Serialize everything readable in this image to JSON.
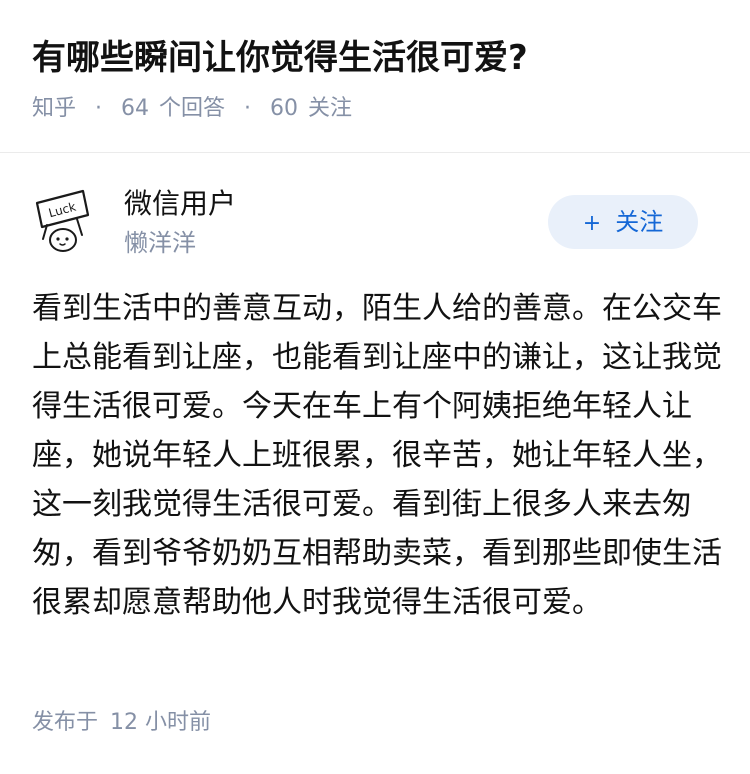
{
  "question": {
    "title": "有哪些瞬间让你觉得生活很可爱?",
    "source": "知乎",
    "separator": "·",
    "answer_count": "64",
    "answer_label": "个回答",
    "follower_count": "60",
    "follower_label": "关注"
  },
  "author": {
    "avatar_icon": "luck-sign-avatar-icon",
    "avatar_text": "Luck",
    "name": "微信用户",
    "bio": "懒洋洋",
    "follow_icon": "plus-icon",
    "follow_plus": "+",
    "follow_label": "关注"
  },
  "answer": {
    "content": "看到生活中的善意互动，陌生人给的善意。在公交车上总能看到让座，也能看到让座中的谦让，这让我觉得生活很可爱。今天在车上有个阿姨拒绝年轻人让座，她说年轻人上班很累，很辛苦，她让年轻人坐，这一刻我觉得生活很可爱。看到街上很多人来去匆匆，看到爷爷奶奶互相帮助卖菜，看到那些即使生活很累却愿意帮助他人时我觉得生活很可爱。",
    "published_label": "发布于",
    "published_time": "12 小时前"
  },
  "colors": {
    "title": "#121212",
    "meta": "#8590a6",
    "follow_bg": "#e9f0fa",
    "follow_text": "#1467d6",
    "divider": "#ebebeb"
  }
}
